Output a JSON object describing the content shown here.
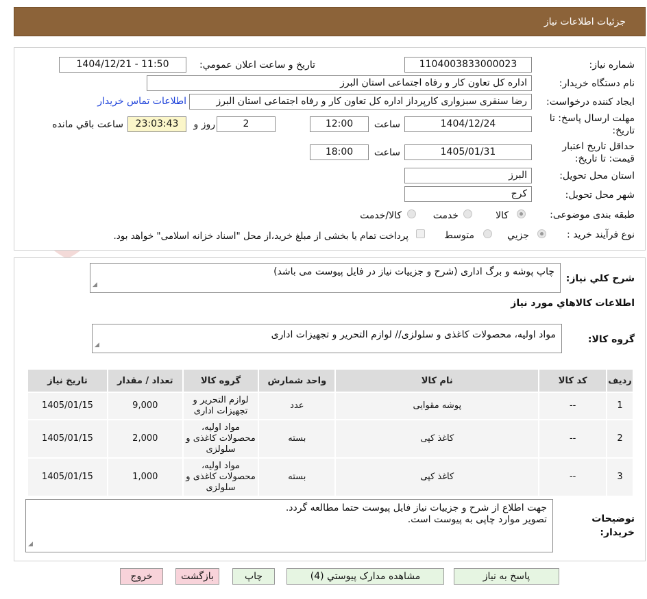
{
  "header": {
    "title": "جزئیات اطلاعات نیاز"
  },
  "form": {
    "need_number_label": "شماره نیاز:",
    "need_number": "1104003833000023",
    "announce_label": "تاریخ و ساعت اعلان عمومي:",
    "announce_value": "1404/12/21 - 11:50",
    "buyer_org_label": "نام دستگاه خریدار:",
    "buyer_org": "اداره کل تعاون  کار و رفاه اجتماعی استان البرز",
    "requester_label": "ایجاد کننده درخواست:",
    "requester": "رضا سنقری سبزواری کارپرداز اداره کل تعاون  کار و رفاه اجتماعی استان البرز",
    "contact_link": "اطلاعات تماس خریدار",
    "deadline_label": "مهلت ارسال پاسخ: تا تاریخ:",
    "deadline_date": "1404/12/24",
    "time_label": "ساعت",
    "deadline_time": "12:00",
    "days_value": "2",
    "days_label": "روز و",
    "remaining_time": "23:03:43",
    "remaining_label": "ساعت باقي مانده",
    "validity_label": "حداقل تاریخ اعتبار قیمت: تا تاریخ:",
    "validity_date": "1405/01/31",
    "validity_time_label": "ساعت",
    "validity_time": "18:00",
    "province_label": "استان محل تحویل:",
    "province": "البرز",
    "city_label": "شهر محل تحویل:",
    "city": "کرج",
    "category_label": "طبقه بندی موضوعی:",
    "category_options": [
      "کالا",
      "خدمت",
      "کالا/خدمت"
    ],
    "process_label": "نوع فرآیند خرید :",
    "process_options": [
      "جزیي",
      "متوسط"
    ],
    "payment_note": "پرداخت تمام یا بخشی از مبلغ خرید،از محل \"اسناد خزانه اسلامی\" خواهد بود."
  },
  "summary": {
    "label": "شرح کلي نیاز:",
    "text": "چاپ پوشه و برگ اداری (شرح و جزییات نیاز در فایل پیوست می باشد)",
    "goods_info_title": "اطلاعات کالاهاي مورد نیاز",
    "group_label": "گروه کالا:",
    "group_text": "مواد اولیه، محصولات کاغذی و سلولزی// لوازم التحریر و تجهیزات اداری"
  },
  "table": {
    "headers": [
      "ردیف",
      "کد کالا",
      "نام کالا",
      "واحد شمارش",
      "گروه کالا",
      "تعداد / مقدار",
      "تاریخ نیاز"
    ],
    "rows": [
      {
        "row": "1",
        "code": "--",
        "name": "پوشه مقوایی",
        "unit": "عدد",
        "group": "لوازم التحریر و تجهیزات اداری",
        "qty": "9,000",
        "date": "1405/01/15"
      },
      {
        "row": "2",
        "code": "--",
        "name": "کاغذ کپی",
        "unit": "بسته",
        "group": "مواد اولیه، محصولات کاغذی و سلولزی",
        "qty": "2,000",
        "date": "1405/01/15"
      },
      {
        "row": "3",
        "code": "--",
        "name": "کاغذ کپی",
        "unit": "بسته",
        "group": "مواد اولیه، محصولات کاغذی و سلولزی",
        "qty": "1,000",
        "date": "1405/01/15"
      }
    ]
  },
  "buyer_notes": {
    "label": "توضیحات خریدار:",
    "line1": "جهت اطلاع از شرح و جزییات نیاز فایل پیوست حتما مطالعه گردد.",
    "line2": "تصویر موارد چاپی به پیوست است."
  },
  "buttons": {
    "reply": "پاسخ به نیاز",
    "attachments": "مشاهده مدارک پیوستي (4)",
    "print": "چاپ",
    "back": "بازگشت",
    "exit": "خروج"
  },
  "watermark": {
    "text": "AriaTender.neT"
  },
  "colors": {
    "header_bg": "#8c6339",
    "link": "#1a3fd9",
    "btn_green": "#e6f5e2",
    "btn_pink": "#f8d3da",
    "timer_bg": "#fbf6c9"
  }
}
